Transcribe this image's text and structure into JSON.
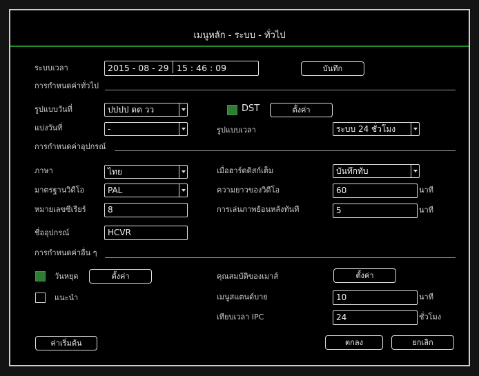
{
  "window": {
    "title": "เมนูหลัก - ระบบ - ทั่วไป"
  },
  "time": {
    "label": "ระบบเวลา",
    "date_value": "2015 - 08 - 29",
    "time_value": "15 : 46 : 09",
    "save_button": "บันทึก"
  },
  "general": {
    "section_title": "การกำหนดค่าทั่วไป",
    "date_format": {
      "label": "รูปแบบวันที่",
      "value": "ปปปป ดด วว"
    },
    "dst": {
      "label": "DST",
      "checked": true,
      "setup_button": "ตั้งค่า"
    },
    "date_separator": {
      "label": "แบ่งวันที่",
      "value": "-"
    },
    "time_format": {
      "label": "รูปแบบเวลา",
      "value": "ระบบ 24 ชั่วโมง"
    }
  },
  "device": {
    "section_title": "การกำหนดค่าอุปกรณ์",
    "language": {
      "label": "ภาษา",
      "value": "ไทย"
    },
    "hdd_full": {
      "label": "เมื่อฮาร์ดดิสก์เต็ม",
      "value": "บันทึกทับ"
    },
    "video_standard": {
      "label": "มาตรฐานวิดีโอ",
      "value": "PAL"
    },
    "video_length": {
      "label": "ความยาวของวิดีโอ",
      "value": "60",
      "unit": "นาที"
    },
    "serial_number": {
      "label": "หมายเลขซีเรียร์",
      "value": "8"
    },
    "instant_playback": {
      "label": "การเล่นภาพย้อนหลังทันที",
      "value": "5",
      "unit": "นาที"
    },
    "device_name": {
      "label": "ชื่ออุปกรณ์",
      "value": "HCVR"
    }
  },
  "other": {
    "section_title": "การกำหนดค่าอื่น ๆ",
    "holiday": {
      "label": "วันหยุด",
      "checked": true,
      "setup_button": "ตั้งค่า"
    },
    "mouse_property": {
      "label": "คุณสมบัติของเมาส์",
      "setup_button": "ตั้งค่า"
    },
    "guide": {
      "label": "แนะนำ",
      "checked": false
    },
    "menu_standby": {
      "label": "เมนูสแตนด์บาย",
      "value": "10",
      "unit": "นาที"
    },
    "ipc_time_sync": {
      "label": "เทียบเวลา IPC",
      "value": "24",
      "unit": "ชั่วโมง"
    }
  },
  "footer": {
    "default_button": "ค่าเริ่มต้น",
    "ok_button": "ตกลง",
    "cancel_button": "ยกเลิก"
  },
  "colors": {
    "accent": "#1f8f2a",
    "checkbox_on": "#2e7d32",
    "background": "#000000"
  }
}
